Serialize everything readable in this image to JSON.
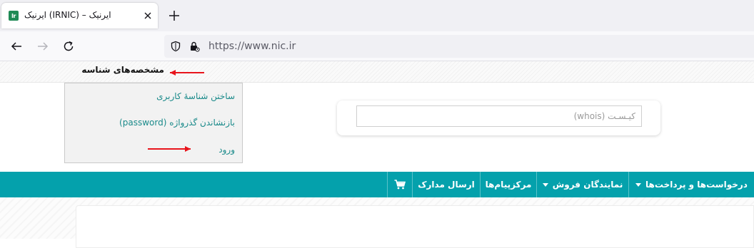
{
  "browser": {
    "tab_title": "ایرنیک – (IRNIC) ایرنیک",
    "favicon_text": "Ir",
    "url": "https://www.nic.ir"
  },
  "header": {
    "identity_label": "مشخصه‌های شناسه"
  },
  "account_menu": {
    "items": [
      {
        "label": "ساختن شناسهٔ کاربری"
      },
      {
        "label": "بازنشاندن گذرواژه (password)"
      },
      {
        "label": "ورود"
      }
    ]
  },
  "search": {
    "placeholder": "کیـسـت (whois)"
  },
  "main_menu": {
    "items": [
      {
        "label": "درخواست‌ها و پرداخت‌ها",
        "dropdown": true
      },
      {
        "label": "نمایندگان فروش",
        "dropdown": true
      },
      {
        "label": "مرکزپیام‌ها",
        "dropdown": false
      },
      {
        "label": "ارسال مدارک",
        "dropdown": false
      }
    ],
    "cart_icon": "shopping-cart-icon"
  },
  "colors": {
    "teal_bar": "#04a1ac",
    "link": "#1a8a8a",
    "annotation_arrow": "#e8141c"
  }
}
